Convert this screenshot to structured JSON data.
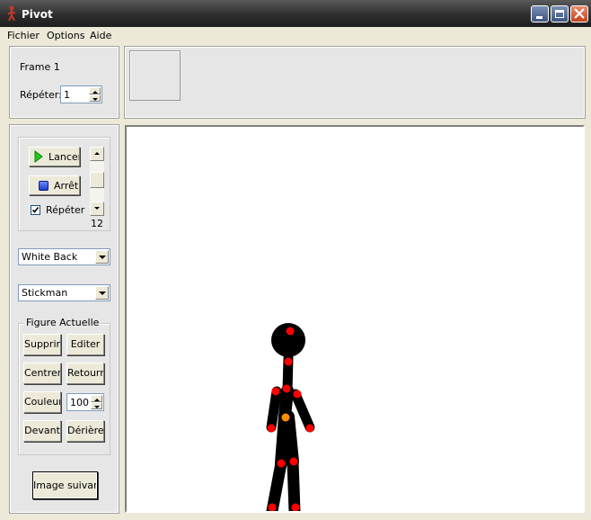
{
  "window": {
    "title": "Pivot"
  },
  "menu": {
    "items": [
      "Fichier",
      "Options",
      "Aide"
    ]
  },
  "frame_panel": {
    "frame_label": "Frame 1",
    "repeat_label": "Répéter:",
    "repeat_value": "1"
  },
  "controls": {
    "play_label": "Lancer",
    "stop_label": "Arrêt",
    "loop_label": "Répéter",
    "loop_checked": true,
    "speed_value": "12"
  },
  "background_select": {
    "value": "White Back"
  },
  "figure_type_select": {
    "value": "Stickman"
  },
  "current_figure": {
    "group_label": "Figure Actuelle",
    "delete_label": "Supprimer",
    "edit_label": "Editer",
    "center_label": "Centrer",
    "flip_label": "Retourner",
    "color_label": "Couleur",
    "color_value": "100",
    "front_label": "Devant",
    "back_label": "Dérière"
  },
  "next_frame_button": {
    "label": "Image suivante"
  },
  "colors": {
    "joint_red": "#ff0000",
    "joint_orange": "#ff8c00",
    "figure": "#000000",
    "canvas": "#ffffff",
    "titlebar": "#2e2e2e"
  }
}
